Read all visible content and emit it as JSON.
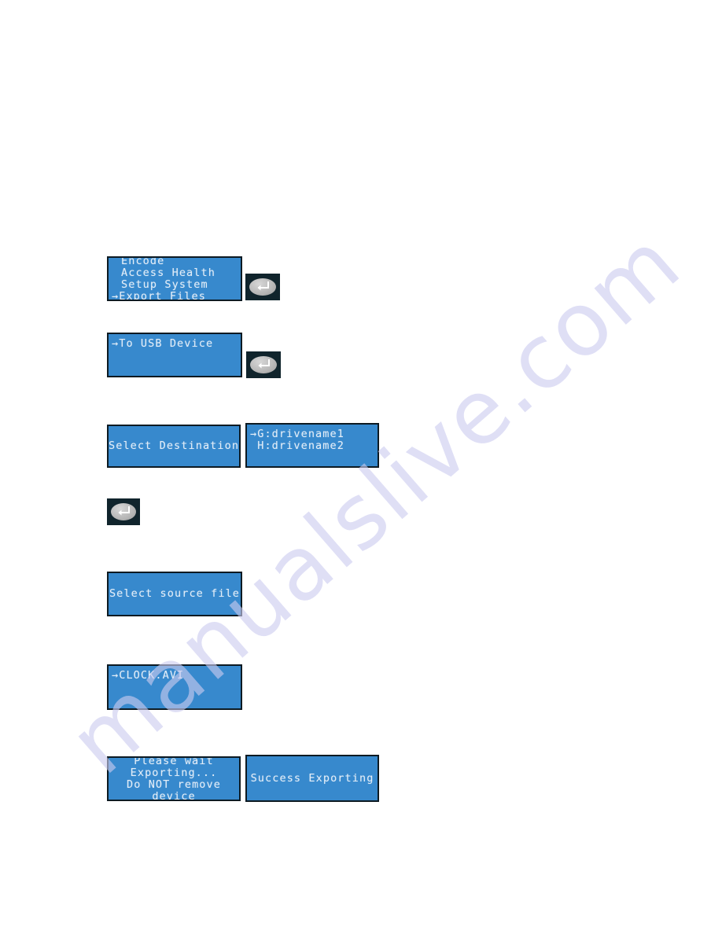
{
  "page": {
    "watermark": "manualslive.com",
    "background_color": "#ffffff",
    "lcd_background_color": "#3789cd",
    "lcd_text_color": "#e2edf8",
    "lcd_border_color": "#0d1a22",
    "key_face_color": "#b6b6b6",
    "key_bezel_color": "#10242c"
  },
  "screens": {
    "main_menu": {
      "name": "main-menu-screen",
      "lines": [
        "Encode",
        "Access Health",
        "Setup System",
        "→Export Files"
      ]
    },
    "usb_device": {
      "name": "usb-destination-screen",
      "lines": [
        "→To USB Device"
      ]
    },
    "select_destination": {
      "name": "select-destination-screen",
      "lines": [
        "Select Destination"
      ]
    },
    "drive_list": {
      "name": "drive-list-screen",
      "lines": [
        "→G:drivename1",
        " H:drivename2"
      ]
    },
    "select_source": {
      "name": "select-source-file-screen",
      "lines": [
        "Select source file"
      ]
    },
    "clock_file": {
      "name": "source-file-screen",
      "lines": [
        "→CLOCK.AVI"
      ]
    },
    "exporting": {
      "name": "exporting-progress-screen",
      "lines": [
        "Please wait",
        "Exporting...",
        "Do NOT remove",
        "device"
      ]
    },
    "success": {
      "name": "export-success-screen",
      "lines": [
        "Success Exporting"
      ]
    }
  },
  "keys": {
    "enter_after_main_menu": {
      "icon": "enter-return-icon",
      "label": ""
    },
    "enter_after_usb_device": {
      "icon": "enter-return-icon",
      "label": ""
    },
    "enter_after_drive_select": {
      "icon": "enter-return-icon",
      "label": ""
    }
  }
}
